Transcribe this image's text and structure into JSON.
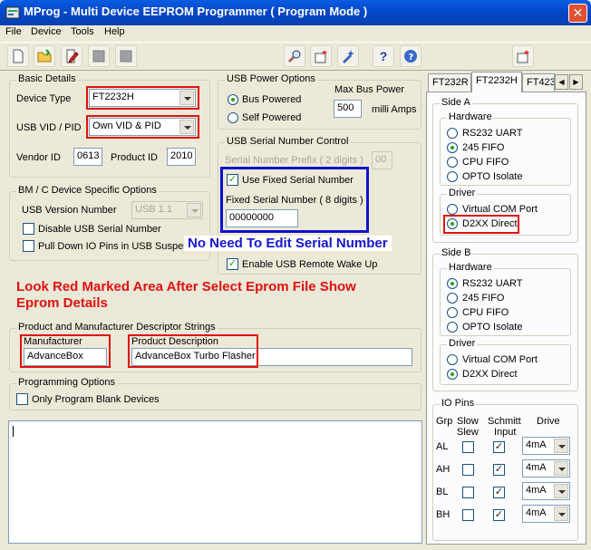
{
  "window": {
    "title": "MProg - Multi Device EEPROM Programmer ( Program Mode )",
    "close_glyph": "✕"
  },
  "menu": [
    "File",
    "Device",
    "Tools",
    "Help"
  ],
  "toolbar": {
    "icons": [
      "new-icon",
      "open-icon",
      "edit-icon",
      "stop-icon",
      "stop-icon",
      "search-icon",
      "program-icon",
      "erase-icon",
      "help-icon",
      "about-icon",
      "parse-icon"
    ],
    "help_glyph": "?"
  },
  "basic": {
    "legend": "Basic Details",
    "device_type_label": "Device Type",
    "device_type_value": "FT2232H",
    "vidpid_label": "USB VID / PID",
    "vidpid_value": "Own VID & PID",
    "vendor_id_label": "Vendor ID",
    "vendor_id_value": "0613",
    "product_id_label": "Product ID",
    "product_id_value": "2010"
  },
  "bm": {
    "legend": "BM / C Device Specific Options",
    "usb_version_label": "USB Version Number",
    "usb_version_value": "USB 1.1",
    "disable_serial_label": "Disable USB Serial Number",
    "pulldown_label": "Pull Down IO Pins in USB Suspend"
  },
  "power": {
    "legend": "USB Power Options",
    "bus_powered": "Bus Powered",
    "self_powered": "Self Powered",
    "max_bus_label": "Max Bus Power",
    "max_bus_value": "500",
    "milli_amps": "milli Amps"
  },
  "serial": {
    "legend": "USB Serial Number Control",
    "prefix_label": "Serial Number Prefix ( 2 digits )",
    "prefix_value": "00",
    "use_fixed_label": "Use Fixed Serial Number",
    "fixed_label": "Fixed Serial Number ( 8 digits )",
    "fixed_value": "00000000",
    "remote_wake_label": "Enable USB Remote Wake Up"
  },
  "annotations": {
    "blue_note": "No Need To Edit Serial Number",
    "red_note": "Look Red Marked Area After Select Eprom File Show\nEprom Details"
  },
  "descriptors": {
    "legend": "Product and Manufacturer Descriptor Strings",
    "manufacturer_label": "Manufacturer",
    "manufacturer_value": "AdvanceBox",
    "product_label": "Product Description",
    "product_value": "AdvanceBox Turbo Flasher"
  },
  "programming": {
    "legend": "Programming Options",
    "blank_label": "Only Program Blank Devices"
  },
  "tabs": [
    "FT232R",
    "FT2232H",
    "FT423"
  ],
  "side_a": {
    "legend": "Side A",
    "hardware_legend": "Hardware",
    "hardware": [
      "RS232 UART",
      "245 FIFO",
      "CPU FIFO",
      "OPTO Isolate"
    ],
    "hardware_selected": 1,
    "driver_legend": "Driver",
    "driver": [
      "Virtual COM Port",
      "D2XX Direct"
    ],
    "driver_selected": 1
  },
  "side_b": {
    "legend": "Side B",
    "hardware_legend": "Hardware",
    "hardware": [
      "RS232 UART",
      "245 FIFO",
      "CPU FIFO",
      "OPTO Isolate"
    ],
    "hardware_selected": 0,
    "driver_legend": "Driver",
    "driver": [
      "Virtual COM Port",
      "D2XX Direct"
    ],
    "driver_selected": 1
  },
  "io_pins": {
    "legend": "IO Pins",
    "col_grp": "Grp",
    "col_slow": "Slow",
    "col_slew": "Slew",
    "col_schmitt": "Schmitt",
    "col_input": "Input",
    "col_drive": "Drive",
    "rows": [
      {
        "grp": "AL",
        "drive": "4mA"
      },
      {
        "grp": "AH",
        "drive": "4mA"
      },
      {
        "grp": "BL",
        "drive": "4mA"
      },
      {
        "grp": "BH",
        "drive": "4mA"
      }
    ]
  },
  "colors": {
    "titlebar": "#0a4fd0",
    "annotation_red": "#e01010",
    "annotation_blue": "#1010cc",
    "check": "#21a121"
  }
}
